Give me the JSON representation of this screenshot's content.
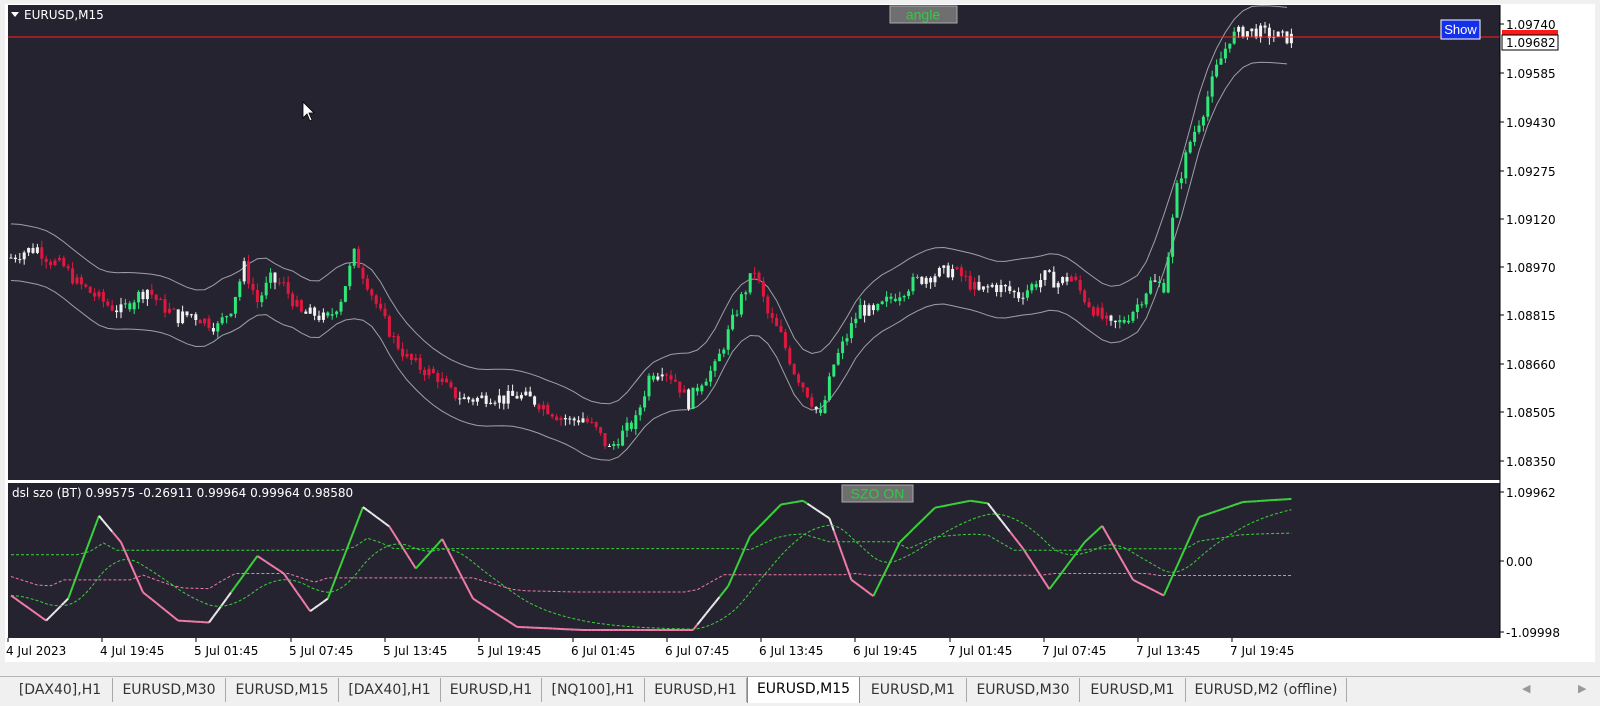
{
  "colors": {
    "background": "#262330",
    "bull": "#2ee877",
    "bear": "#e0173f",
    "neutral": "#f2f2f2",
    "band": "#9ea0a8",
    "price_line": "#ff2020",
    "osc_green": "#3ad23a",
    "osc_pink": "#f07aa8",
    "osc_white": "#e8e8e8"
  },
  "main_chart": {
    "symbol_label": "EURUSD,M15",
    "angle_button": "angle",
    "show_button": "Show",
    "current_price_label": "1.09682",
    "price_ticks": [
      "1.09740",
      "1.09585",
      "1.09430",
      "1.09275",
      "1.09120",
      "1.08970",
      "1.08815",
      "1.08660",
      "1.08505",
      "1.08350"
    ]
  },
  "indicator": {
    "label": "dsl szo (BT) 0.99575 -0.26911 0.99964 0.99964 0.98580",
    "szo_button": "SZO ON",
    "ticks": [
      "1.09962",
      "0.00",
      "-1.09998"
    ]
  },
  "time_axis": [
    "4 Jul 2023",
    "4 Jul 19:45",
    "5 Jul 01:45",
    "5 Jul 07:45",
    "5 Jul 13:45",
    "5 Jul 19:45",
    "6 Jul 01:45",
    "6 Jul 07:45",
    "6 Jul 13:45",
    "6 Jul 19:45",
    "7 Jul 01:45",
    "7 Jul 07:45",
    "7 Jul 13:45",
    "7 Jul 19:45"
  ],
  "tabs": [
    {
      "label": "[DAX40],H1",
      "active": false
    },
    {
      "label": "EURUSD,M30",
      "active": false
    },
    {
      "label": "EURUSD,M15",
      "active": false
    },
    {
      "label": "[DAX40],H1",
      "active": false
    },
    {
      "label": "EURUSD,H1",
      "active": false
    },
    {
      "label": "[NQ100],H1",
      "active": false
    },
    {
      "label": "EURUSD,H1",
      "active": false
    },
    {
      "label": "EURUSD,M15",
      "active": true
    },
    {
      "label": "EURUSD,M1",
      "active": false
    },
    {
      "label": "EURUSD,M30",
      "active": false
    },
    {
      "label": "EURUSD,M1",
      "active": false
    },
    {
      "label": "EURUSD,M2 (offline)",
      "active": false
    }
  ],
  "price_path": [
    [
      0,
      1.0898
    ],
    [
      3,
      1.09
    ],
    [
      6,
      1.0901
    ],
    [
      9,
      1.0897
    ],
    [
      12,
      1.0895
    ],
    [
      15,
      1.089
    ],
    [
      19,
      1.0886
    ],
    [
      22,
      1.0883
    ],
    [
      25,
      1.0881
    ],
    [
      28,
      1.0885
    ],
    [
      31,
      1.0888
    ],
    [
      34,
      1.0883
    ],
    [
      38,
      1.0879
    ],
    [
      41,
      1.088
    ],
    [
      44,
      1.0878
    ],
    [
      47,
      1.0876
    ],
    [
      50,
      1.0882
    ],
    [
      53,
      1.0895
    ],
    [
      56,
      1.0884
    ],
    [
      59,
      1.0891
    ],
    [
      62,
      1.0889
    ],
    [
      66,
      1.088
    ],
    [
      69,
      1.088
    ],
    [
      72,
      1.0878
    ],
    [
      75,
      1.0885
    ],
    [
      78,
      1.0899
    ],
    [
      81,
      1.089
    ],
    [
      84,
      1.088
    ],
    [
      87,
      1.0872
    ],
    [
      90,
      1.0866
    ],
    [
      93,
      1.0863
    ],
    [
      97,
      1.086
    ],
    [
      100,
      1.0855
    ],
    [
      103,
      1.0853
    ],
    [
      106,
      1.0853
    ],
    [
      109,
      1.0854
    ],
    [
      112,
      1.0853
    ],
    [
      115,
      1.0854
    ],
    [
      118,
      1.0853
    ],
    [
      121,
      1.0851
    ],
    [
      124,
      1.0848
    ],
    [
      127,
      1.0846
    ],
    [
      130,
      1.0847
    ],
    [
      133,
      1.0843
    ],
    [
      136,
      1.0837
    ],
    [
      139,
      1.0842
    ],
    [
      142,
      1.0846
    ],
    [
      145,
      1.086
    ],
    [
      148,
      1.0863
    ],
    [
      151,
      1.0859
    ],
    [
      154,
      1.0852
    ],
    [
      157,
      1.0859
    ],
    [
      160,
      1.0863
    ],
    [
      163,
      1.0874
    ],
    [
      166,
      1.0885
    ],
    [
      169,
      1.0894
    ],
    [
      172,
      1.088
    ],
    [
      175,
      1.0873
    ],
    [
      178,
      1.0862
    ],
    [
      181,
      1.0855
    ],
    [
      184,
      1.0847
    ],
    [
      187,
      1.0864
    ],
    [
      190,
      1.0873
    ],
    [
      193,
      1.0882
    ],
    [
      196,
      1.088
    ],
    [
      199,
      1.0884
    ],
    [
      202,
      1.0887
    ],
    [
      205,
      1.089
    ],
    [
      208,
      1.0892
    ],
    [
      211,
      1.0893
    ],
    [
      214,
      1.0894
    ],
    [
      217,
      1.0891
    ],
    [
      220,
      1.0887
    ],
    [
      223,
      1.0889
    ],
    [
      226,
      1.0888
    ],
    [
      229,
      1.0886
    ],
    [
      232,
      1.0889
    ],
    [
      235,
      1.0892
    ],
    [
      238,
      1.089
    ],
    [
      241,
      1.0892
    ],
    [
      244,
      1.0885
    ],
    [
      247,
      1.088
    ],
    [
      250,
      1.0876
    ],
    [
      253,
      1.0878
    ],
    [
      256,
      1.0883
    ],
    [
      259,
      1.089
    ],
    [
      262,
      1.0889
    ],
    [
      265,
      1.092
    ],
    [
      268,
      1.0935
    ],
    [
      271,
      1.0945
    ],
    [
      274,
      1.0958
    ],
    [
      277,
      1.0968
    ],
    [
      280,
      1.097
    ],
    [
      283,
      1.097
    ],
    [
      286,
      1.0969
    ],
    [
      289,
      1.0968
    ],
    [
      291,
      1.0968
    ]
  ],
  "osc_path": [
    [
      0,
      -0.55
    ],
    [
      8,
      -0.95
    ],
    [
      13,
      -0.6
    ],
    [
      20,
      0.72
    ],
    [
      25,
      0.3
    ],
    [
      30,
      -0.5
    ],
    [
      38,
      -0.95
    ],
    [
      45,
      -0.98
    ],
    [
      49,
      -0.6
    ],
    [
      56,
      0.08
    ],
    [
      62,
      -0.2
    ],
    [
      68,
      -0.8
    ],
    [
      72,
      -0.6
    ],
    [
      80,
      0.86
    ],
    [
      86,
      0.55
    ],
    [
      92,
      -0.12
    ],
    [
      98,
      0.35
    ],
    [
      105,
      -0.6
    ],
    [
      115,
      -1.05
    ],
    [
      130,
      -1.1
    ],
    [
      140,
      -1.1
    ],
    [
      155,
      -1.1
    ],
    [
      163,
      -0.4
    ],
    [
      168,
      0.4
    ],
    [
      175,
      0.9
    ],
    [
      180,
      0.96
    ],
    [
      186,
      0.68
    ],
    [
      191,
      -0.3
    ],
    [
      196,
      -0.56
    ],
    [
      202,
      0.3
    ],
    [
      210,
      0.85
    ],
    [
      218,
      0.96
    ],
    [
      222,
      0.92
    ],
    [
      230,
      0.2
    ],
    [
      236,
      -0.45
    ],
    [
      244,
      0.3
    ],
    [
      248,
      0.56
    ],
    [
      255,
      -0.3
    ],
    [
      262,
      -0.55
    ],
    [
      270,
      0.7
    ],
    [
      280,
      0.94
    ],
    [
      291,
      0.99
    ]
  ]
}
